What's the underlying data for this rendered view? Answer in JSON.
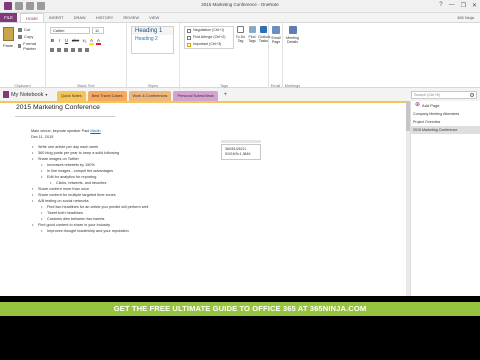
{
  "window": {
    "title": "2015 Marketing Conference - OneNote",
    "controls": [
      "?",
      "—",
      "❐",
      "✕"
    ]
  },
  "ribbon_tabs": {
    "file": "FILE",
    "tabs": [
      "HOME",
      "INSERT",
      "DRAW",
      "HISTORY",
      "REVIEW",
      "VIEW"
    ],
    "active": "HOME",
    "user": "365 Ninja"
  },
  "clipboard": {
    "paste": "Paste",
    "cut": "Cut",
    "copy": "Copy",
    "format_painter": "Format Painter",
    "label": "Clipboard"
  },
  "basic_text": {
    "font": "Calibri",
    "size": "11",
    "format_buttons": [
      "B",
      "I",
      "U",
      "abc",
      "x₂",
      "A",
      "A"
    ],
    "label": "Basic Text",
    "highlight_color": "#ffe600",
    "font_color": "#e02020"
  },
  "styles": {
    "items": [
      "Heading 1",
      "Heading 2"
    ],
    "label": "Styles"
  },
  "tags": {
    "items": [
      "Negotiation (Ctrl+1)",
      "Find Attrnge (Ctrl+2)",
      "Important (Ctrl+3)"
    ],
    "todo": "To Do Tag",
    "find": "Find Tags",
    "outlook": "Outlook Tasks",
    "label": "Tags"
  },
  "email": {
    "button": "Email Page",
    "label": "Email"
  },
  "meetings": {
    "button": "Meeting Details",
    "label": "Meetings"
  },
  "notebook": {
    "name": "My Notebook",
    "sections": [
      {
        "label": "Quick Notes",
        "color": "#f4c55a"
      },
      {
        "label": "Best Travel Cases",
        "color": "#f7a85f"
      },
      {
        "label": "Work & Conferences",
        "color": "#f0b77b"
      },
      {
        "label": "Personal Notes/Ideas",
        "color": "#d5a3d2"
      }
    ],
    "add_section": "+",
    "search_placeholder": "Search (Ctrl+E)"
  },
  "page": {
    "title": "2015 Marketing Conference",
    "lines": [
      {
        "level": 0,
        "text": "Main venue, keynote speaker Paul ",
        "link": "Marlin"
      },
      {
        "level": 0,
        "text": "Dec 11, 2015"
      },
      {
        "level": -1,
        "text": ""
      },
      {
        "level": 1,
        "text": "Write one article per day each week"
      },
      {
        "level": 1,
        "text": "360 blog posts per year to keep a solid following"
      },
      {
        "level": 1,
        "text": "Share images on Twitter"
      },
      {
        "level": 2,
        "text": "Increases retweets by 150%"
      },
      {
        "level": 2,
        "text": "In line images - compel the advantages"
      },
      {
        "level": 2,
        "text": "Edit for analytics for reporting"
      },
      {
        "level": 3,
        "text": "Clicks, retweets, and favorites"
      },
      {
        "level": 1,
        "text": "Share content more than once"
      },
      {
        "level": 1,
        "text": "Share content for multiple targeted time zones"
      },
      {
        "level": 1,
        "text": "A/B testing on social networks"
      },
      {
        "level": 2,
        "text": "Find two headlines for an article you predict will perform well"
      },
      {
        "level": 2,
        "text": "Tweet both headlines"
      },
      {
        "level": 2,
        "text": "Customs dies between two tweets"
      },
      {
        "level": 1,
        "text": "Find good content to share in your industry"
      },
      {
        "level": 2,
        "text": "Improves thought leadership and your reputation"
      }
    ],
    "note_lines": [
      "360/514/6211",
      "5/3/15/9=1.3846"
    ]
  },
  "pages_pane": {
    "add_page": "Add Page",
    "items": [
      "Company Meeting Attendees",
      "Project Overview",
      "2015 Marketing Conference"
    ],
    "active_index": 2
  },
  "banner": {
    "text": "GET THE FREE ULTIMATE GUIDE TO OFFICE 365 AT 365NINJA.COM",
    "background": "#96c43e"
  },
  "colors": {
    "accent": "#80397b",
    "page_tab": "#f4c55a"
  }
}
